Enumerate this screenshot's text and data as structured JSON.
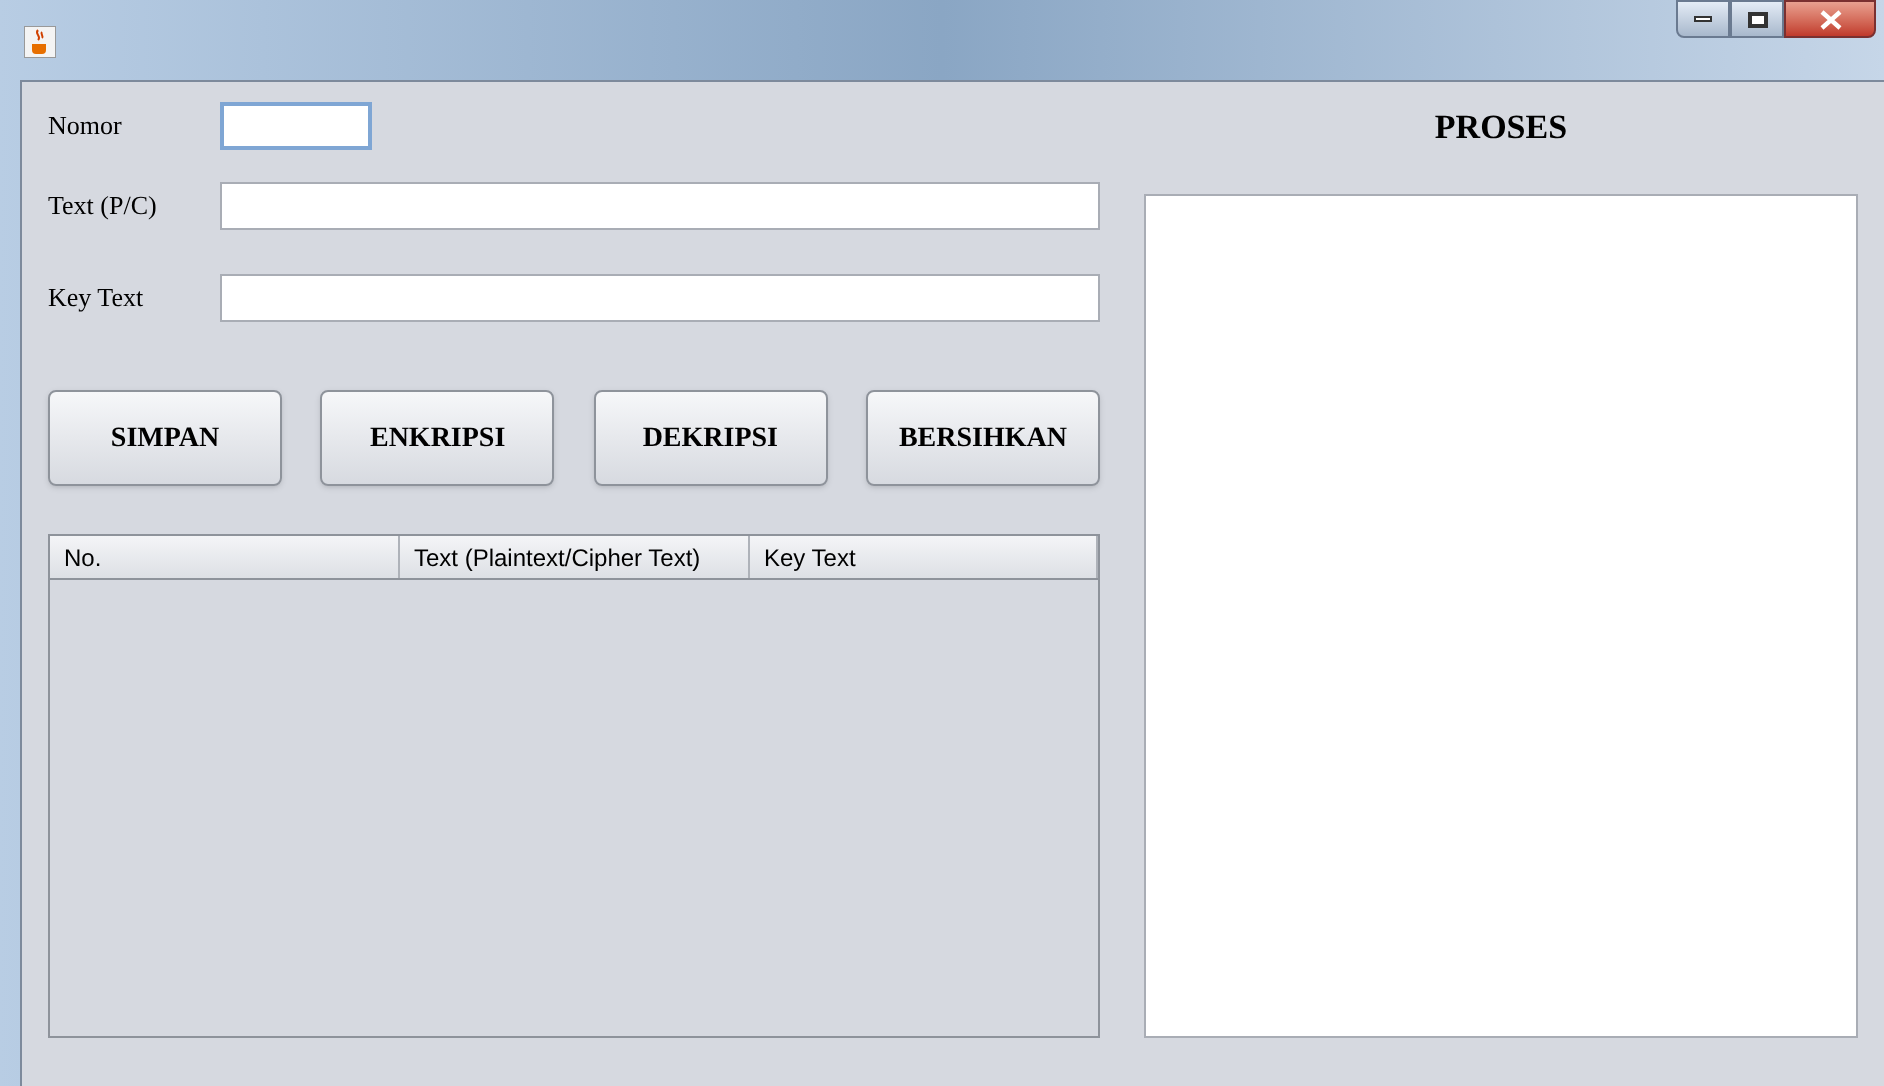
{
  "window": {
    "controls": [
      {
        "kind": "minimize"
      },
      {
        "kind": "maximize"
      },
      {
        "kind": "close"
      }
    ]
  },
  "form": {
    "fields": [
      {
        "label": "Nomor",
        "kind": "short",
        "focused": true
      },
      {
        "label": "Text (P/C)",
        "kind": "wide",
        "focused": false
      },
      {
        "label": "Key Text",
        "kind": "wide",
        "focused": false
      }
    ]
  },
  "buttons": [
    "SIMPAN",
    "ENKRIPSI",
    "DEKRIPSI",
    "BERSIHKAN"
  ],
  "table": {
    "columns": [
      "No.",
      "Text (Plaintext/Cipher Text)",
      "Key Text"
    ]
  },
  "proses": {
    "title": "PROSES"
  }
}
